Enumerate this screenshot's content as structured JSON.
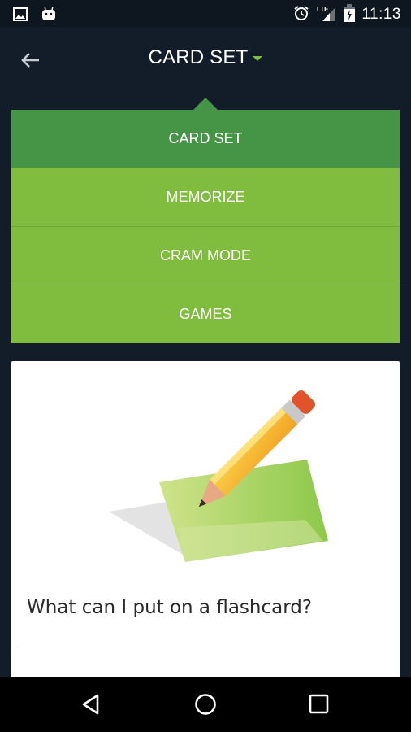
{
  "status_bar": {
    "left_icons": [
      "image-icon",
      "android-icon"
    ],
    "right_icons": [
      "alarm-icon",
      "lte-signal-icon",
      "battery-charging-icon"
    ],
    "network": "LTE",
    "time": "11:13"
  },
  "app_bar": {
    "back_icon": "arrow-left-icon",
    "title": "CARD SET",
    "dropdown_icon": "caret-down-icon"
  },
  "menu": {
    "items": [
      {
        "label": "CARD SET",
        "active": true
      },
      {
        "label": "MEMORIZE",
        "active": false
      },
      {
        "label": "CRAM MODE",
        "active": false
      },
      {
        "label": "GAMES",
        "active": false
      }
    ]
  },
  "card": {
    "illustration": "pencil-on-flashcard-illustration",
    "question": "What can I put on a flashcard?"
  },
  "nav_bar": {
    "buttons": [
      "back-triangle-icon",
      "home-circle-icon",
      "recents-square-icon"
    ]
  },
  "colors": {
    "background": "#121d29",
    "menu_active": "#469446",
    "menu_item": "#80bd3e",
    "accent_caret": "#7cc043"
  }
}
